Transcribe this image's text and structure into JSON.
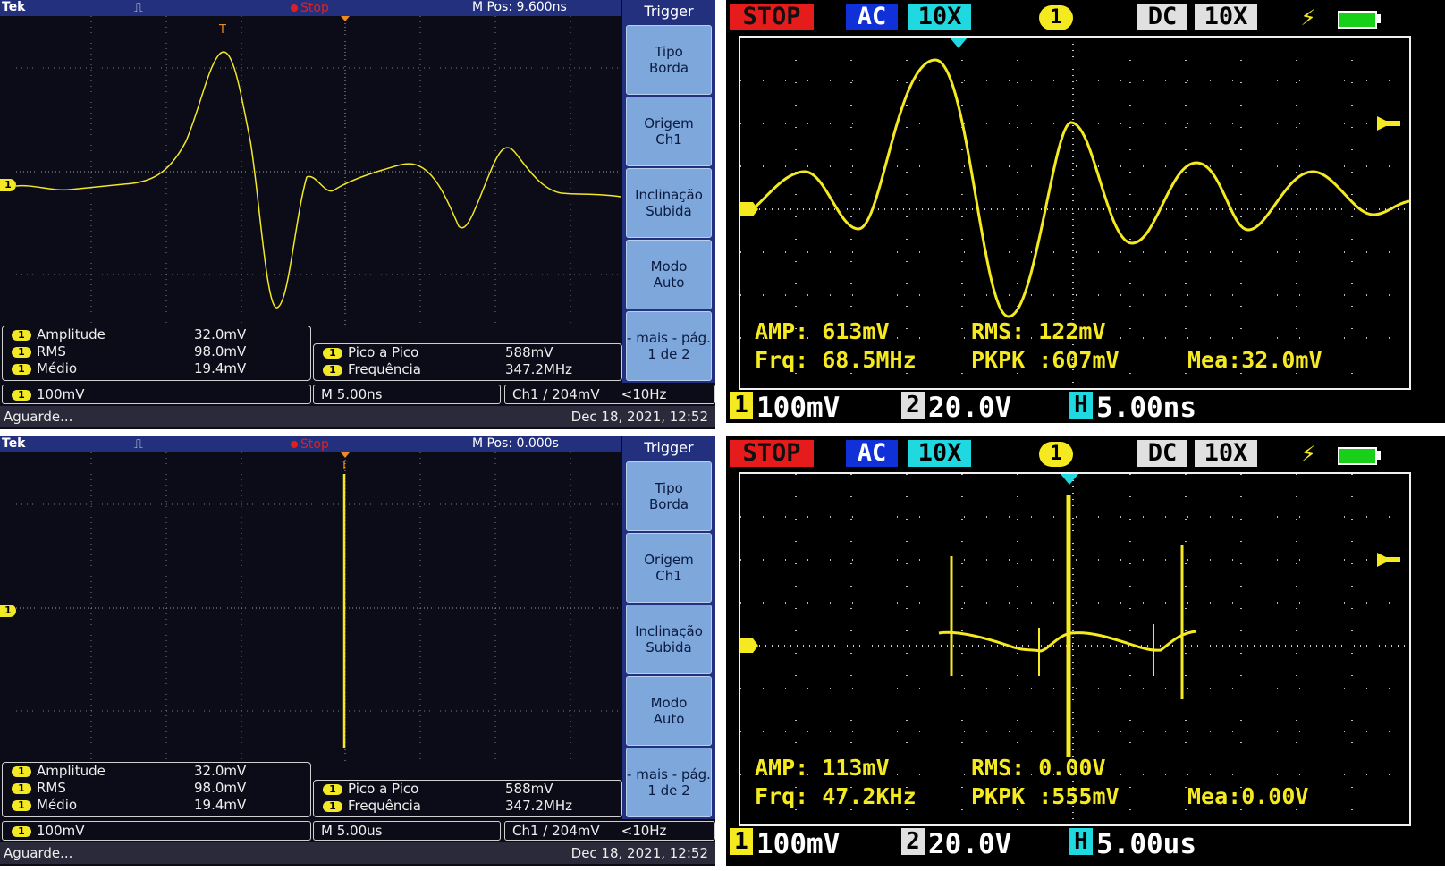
{
  "tek_top": {
    "brand": "Tek",
    "stop": "Stop",
    "mpos": "M Pos: 9.600ns",
    "trigger_marker": "T",
    "ch_marker": "1",
    "menu": {
      "title": "Trigger",
      "buttons": [
        {
          "l1": "Tipo",
          "l2": "Borda"
        },
        {
          "l1": "Origem",
          "l2": "Ch1"
        },
        {
          "l1": "Inclinação",
          "l2": "Subida"
        },
        {
          "l1": "Modo",
          "l2": "Auto"
        },
        {
          "l1": "- mais - pág.",
          "l2": "1 de 2"
        }
      ]
    },
    "meas_left": [
      {
        "ch": "1",
        "name": "Amplitude",
        "value": "32.0mV"
      },
      {
        "ch": "1",
        "name": "RMS",
        "value": "98.0mV"
      },
      {
        "ch": "1",
        "name": "Médio",
        "value": "19.4mV"
      }
    ],
    "meas_right": [
      {
        "ch": "1",
        "name": "Pico a Pico",
        "value": "588mV"
      },
      {
        "ch": "1",
        "name": "Frequência",
        "value": "347.2MHz"
      }
    ],
    "scale": {
      "ch": "1",
      "volts": "100mV",
      "time": "M 5.00ns",
      "trig": "Ch1 ∕ 204mV",
      "freq": "<10Hz"
    },
    "status": "Aguarde...",
    "date": "Dec 18, 2021, 12:52"
  },
  "tek_bot": {
    "brand": "Tek",
    "stop": "Stop",
    "mpos": "M Pos: 0.000s",
    "trigger_marker": "T",
    "ch_marker": "1",
    "menu": {
      "title": "Trigger",
      "buttons": [
        {
          "l1": "Tipo",
          "l2": "Borda"
        },
        {
          "l1": "Origem",
          "l2": "Ch1"
        },
        {
          "l1": "Inclinação",
          "l2": "Subida"
        },
        {
          "l1": "Modo",
          "l2": "Auto"
        },
        {
          "l1": "- mais - pág.",
          "l2": "1 de 2"
        }
      ]
    },
    "meas_left": [
      {
        "ch": "1",
        "name": "Amplitude",
        "value": "32.0mV"
      },
      {
        "ch": "1",
        "name": "RMS",
        "value": "98.0mV"
      },
      {
        "ch": "1",
        "name": "Médio",
        "value": "19.4mV"
      }
    ],
    "meas_right": [
      {
        "ch": "1",
        "name": "Pico a Pico",
        "value": "588mV"
      },
      {
        "ch": "1",
        "name": "Frequência",
        "value": "347.2MHz"
      }
    ],
    "scale": {
      "ch": "1",
      "volts": "100mV",
      "time": "M 5.00us",
      "trig": "Ch1 ∕ 204mV",
      "freq": "<10Hz"
    },
    "status": "Aguarde...",
    "date": "Dec 18, 2021, 12:52"
  },
  "dso_top": {
    "stop": "STOP",
    "ac": "AC",
    "probe1": "10X",
    "ch": "1",
    "dc": "DC",
    "probe2": "10X",
    "amp": "AMP: 613mV",
    "rms": "RMS: 122mV",
    "frq": "Frq: 68.5MHz",
    "pkpk": "PKPK :607mV",
    "mea": "Mea:32.0mV",
    "f1": "1",
    "f1v": "100mV",
    "f2": "2",
    "f2v": "20.0V",
    "fh": "H",
    "fhv": "5.00ns"
  },
  "dso_bot": {
    "stop": "STOP",
    "ac": "AC",
    "probe1": "10X",
    "ch": "1",
    "dc": "DC",
    "probe2": "10X",
    "amp": "AMP: 113mV",
    "rms": "RMS: 0.00V",
    "frq": "Frq: 47.2KHz",
    "pkpk": "PKPK :555mV",
    "mea": "Mea:0.00V",
    "f1": "1",
    "f1v": "100mV",
    "f2": "2",
    "f2v": "20.0V",
    "fh": "H",
    "fhv": "5.00us"
  },
  "colors": {
    "trace": "#f2e826",
    "tek_blue": "#23307e",
    "menu_btn": "#7ea8dc",
    "stop_red": "#e61c1c",
    "ac_blue": "#1030d8",
    "probe_cyan": "#20d8e0"
  }
}
